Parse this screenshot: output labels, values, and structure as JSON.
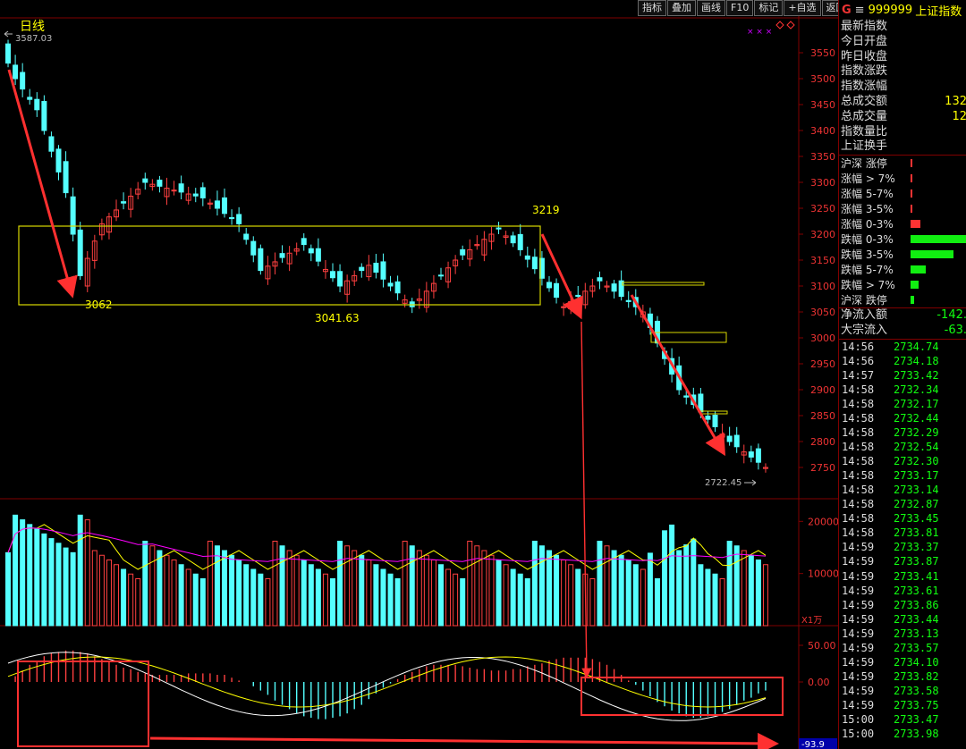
{
  "chart_title": "日线",
  "high_marker": "3587.03",
  "annotations": {
    "a1": "3062",
    "a2": "3041.63",
    "a3": "3219",
    "low": "2722.45"
  },
  "price_axis": [
    "3550",
    "3500",
    "3450",
    "3400",
    "3350",
    "3300",
    "3250",
    "3200",
    "3150",
    "3100",
    "3050",
    "3000",
    "2950",
    "2900",
    "2850",
    "2800",
    "2750"
  ],
  "volume_axis": [
    "20000",
    "10000"
  ],
  "volume_unit": "X1万",
  "macd_axis": [
    "50.00",
    "0.00"
  ],
  "macd_value": "-93.9",
  "toolbar": [
    "指标",
    "叠加",
    "画线",
    "F10",
    "标记",
    "+自选",
    "返回"
  ],
  "header": {
    "g": "G",
    "eq": "≡",
    "code": "999999",
    "name": "上证指数"
  },
  "info_rows": [
    {
      "label": "最新指数",
      "value": ""
    },
    {
      "label": "今日开盘",
      "value": ""
    },
    {
      "label": "昨日收盘",
      "value": ""
    },
    {
      "label": "指数涨跌",
      "value": ""
    },
    {
      "label": "指数涨幅",
      "value": ""
    },
    {
      "label": "总成交额",
      "value": "132"
    },
    {
      "label": "总成交量",
      "value": "12"
    },
    {
      "label": "指数量比",
      "value": ""
    },
    {
      "label": "上证换手",
      "value": ""
    }
  ],
  "breadth_rows": [
    {
      "label": "沪深 涨停",
      "pct": 0.01,
      "color": "#ff3333"
    },
    {
      "label": "涨幅 > 7%",
      "pct": 0.01,
      "color": "#ff3333"
    },
    {
      "label": "涨幅 5-7%",
      "pct": 0.01,
      "color": "#ff3333"
    },
    {
      "label": "涨幅 3-5%",
      "pct": 0.01,
      "color": "#ff3333"
    },
    {
      "label": "涨幅 0-3%",
      "pct": 0.18,
      "color": "#ff3333"
    },
    {
      "label": "跌幅 0-3%",
      "pct": 1.0,
      "color": "#11ee11"
    },
    {
      "label": "跌幅 3-5%",
      "pct": 0.78,
      "color": "#11ee11"
    },
    {
      "label": "跌幅 5-7%",
      "pct": 0.27,
      "color": "#11ee11"
    },
    {
      "label": "跌幅 > 7%",
      "pct": 0.14,
      "color": "#11ee11"
    },
    {
      "label": "沪深 跌停",
      "pct": 0.06,
      "color": "#11ee11"
    }
  ],
  "flow_rows": [
    {
      "label": "净流入额",
      "value": "-142."
    },
    {
      "label": "大宗流入",
      "value": "-63."
    }
  ],
  "ticks": [
    [
      "14:56",
      "2734.74"
    ],
    [
      "14:56",
      "2734.18"
    ],
    [
      "14:57",
      "2733.42"
    ],
    [
      "14:58",
      "2732.34"
    ],
    [
      "14:58",
      "2732.17"
    ],
    [
      "14:58",
      "2732.44"
    ],
    [
      "14:58",
      "2732.29"
    ],
    [
      "14:58",
      "2732.54"
    ],
    [
      "14:58",
      "2732.30"
    ],
    [
      "14:58",
      "2733.17"
    ],
    [
      "14:58",
      "2733.14"
    ],
    [
      "14:58",
      "2732.87"
    ],
    [
      "14:58",
      "2733.45"
    ],
    [
      "14:58",
      "2733.81"
    ],
    [
      "14:59",
      "2733.37"
    ],
    [
      "14:59",
      "2733.87"
    ],
    [
      "14:59",
      "2733.41"
    ],
    [
      "14:59",
      "2733.61"
    ],
    [
      "14:59",
      "2733.86"
    ],
    [
      "14:59",
      "2733.44"
    ],
    [
      "14:59",
      "2733.13"
    ],
    [
      "14:59",
      "2733.57"
    ],
    [
      "14:59",
      "2734.10"
    ],
    [
      "14:59",
      "2733.82"
    ],
    [
      "14:59",
      "2733.58"
    ],
    [
      "14:59",
      "2733.75"
    ],
    [
      "15:00",
      "2733.47"
    ],
    [
      "15:00",
      "2733.98"
    ]
  ],
  "colors": {
    "up": "#ff4040",
    "down": "#54ffff",
    "axis": "#800000",
    "arrow": "#ff3030",
    "box": "#d8d800",
    "ma5": "#ffffff",
    "ma10": "#ffff00",
    "ma20": "#ff00ff"
  }
}
